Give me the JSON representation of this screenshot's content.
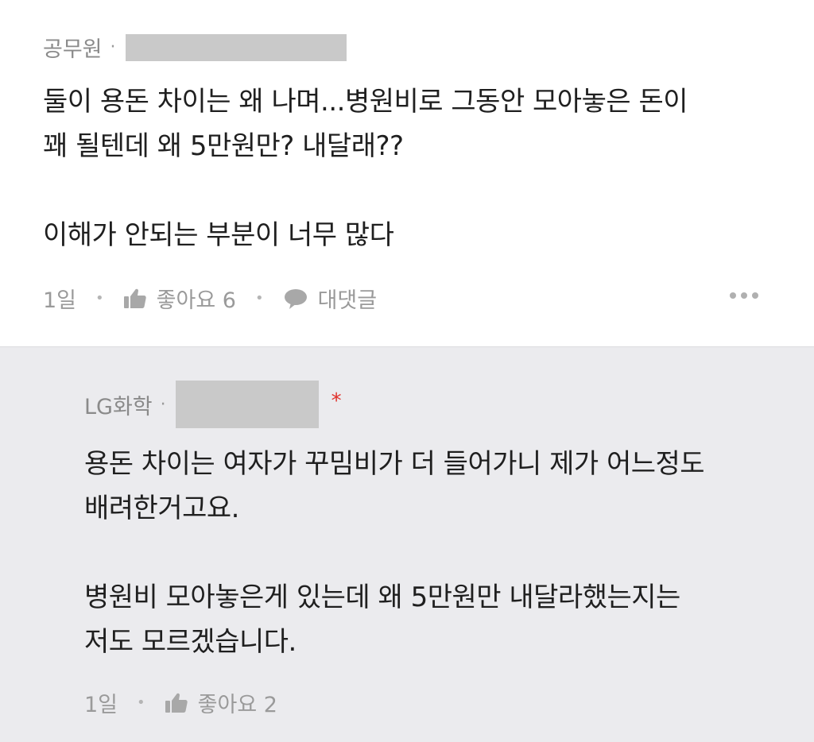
{
  "comment": {
    "author": "공무원",
    "separator": "·",
    "text_lines": [
      "둘이 용돈 차이는 왜 나며...병원비로 그동안 모아놓은 돈이",
      "꽤 될텐데 왜 5만원만? 내달래??"
    ],
    "text_lines_2": [
      "이해가 안되는 부분이 너무 많다"
    ],
    "time": "1일",
    "like_label": "좋아요 6",
    "reply_label": "대댓글"
  },
  "reply": {
    "author": "LG화학",
    "separator": "·",
    "op_marker": "*",
    "text_lines": [
      "용돈 차이는 여자가 꾸밈비가 더 들어가니 제가 어느정도",
      "배려한거고요."
    ],
    "text_lines_2": [
      "병원비 모아놓은게 있는데 왜 5만원만 내달라했는지는",
      "저도 모르겠습니다."
    ],
    "time": "1일",
    "like_label": "좋아요 2"
  },
  "colors": {
    "reply_background": "#ebebee",
    "op_marker": "#e0312b",
    "meta_text": "#8a8a8a"
  },
  "icons": [
    "thumbs-up-icon",
    "speech-bubble-icon",
    "more-dots-icon"
  ]
}
